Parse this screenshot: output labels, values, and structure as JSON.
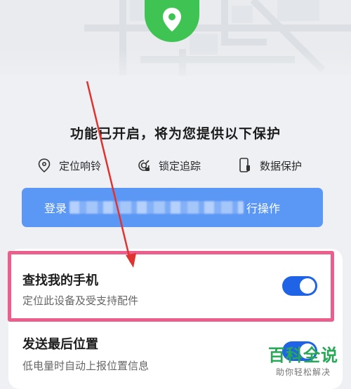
{
  "headline": "功能已开启，将为您提供以下保护",
  "features": [
    {
      "label": "定位响铃",
      "icon": "location-pin-icon"
    },
    {
      "label": "锁定追踪",
      "icon": "lock-track-icon"
    },
    {
      "label": "数据保护",
      "icon": "phone-data-icon"
    }
  ],
  "login_button": {
    "prefix": "登录",
    "suffix": "行操作"
  },
  "settings": [
    {
      "title": "查找我的手机",
      "subtitle": "定位此设备及受支持配件",
      "enabled": true
    },
    {
      "title": "发送最后位置",
      "subtitle": "低电量时自动上报位置信息",
      "enabled": true
    }
  ],
  "colors": {
    "accent": "#1f63e6",
    "login_bg": "#5b97f5",
    "pin_green": "#3fc352",
    "highlight": "#ec5f8c",
    "arrow": "#e0332f"
  },
  "watermark": {
    "title": "百科全说",
    "subtitle": "助你轻松解决"
  }
}
